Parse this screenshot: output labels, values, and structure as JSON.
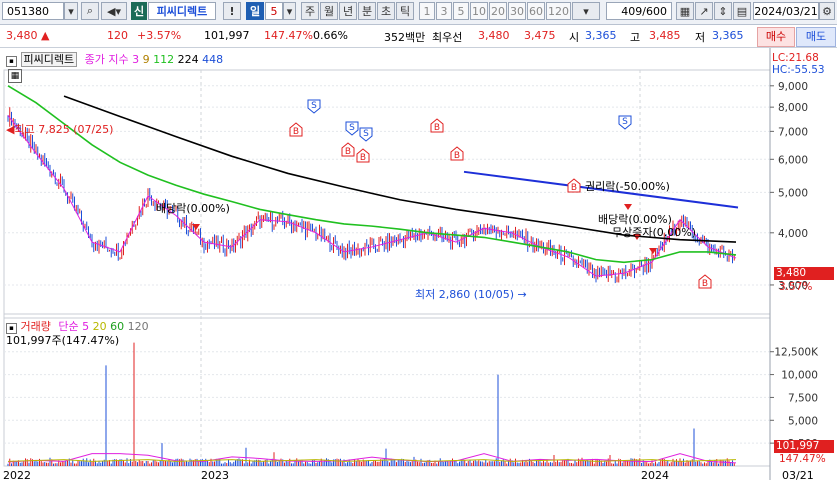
{
  "toolbar": {
    "code": "051380",
    "shin_label": "신",
    "stock_name": "피씨디렉트",
    "alert_label": "!",
    "period_label": "일",
    "period_count": "5",
    "periods": [
      "주",
      "월",
      "년",
      "분",
      "초",
      "틱"
    ],
    "numbers": [
      "1",
      "3",
      "5",
      "10",
      "20",
      "30",
      "60",
      "120"
    ],
    "count": "409/600",
    "date": "2024/03/21"
  },
  "quote": {
    "price": "3,480 ▲",
    "change": "120",
    "change_pct": "+3.57%",
    "volume": "101,997",
    "volume_ratio": "147.47%",
    "turnover": "0.66%",
    "amount": "352백만",
    "best_label": "최우선",
    "best_ask": "3,480",
    "best_bid": "3,475",
    "open_label": "시",
    "open": "3,365",
    "high_label": "고",
    "high": "3,485",
    "low_label": "저",
    "low": "3,365",
    "buy_label": "매수",
    "sell_label": "매도"
  },
  "price_panel": {
    "title": "피씨디렉트",
    "legend_label": "종가 지수",
    "ma_periods": [
      "3",
      "9",
      "112",
      "224",
      "448"
    ],
    "lc": "LC:21.68",
    "hc": "HC:-55.53",
    "current_price_tag": "3,480",
    "current_pct_tag": "3.57%",
    "high_note": "최고 7,825 (07/25)",
    "low_note": "최저 2,860 (10/05)",
    "annotations": [
      "배당락(0.00%)",
      "권리락(-50.00%)",
      "배당락(0.00%)",
      "무상증자(0.00%)"
    ]
  },
  "volume_panel": {
    "title": "거래량",
    "legend_label": "단순",
    "ma_periods": [
      "5",
      "20",
      "60",
      "120"
    ],
    "current_volume": "101,997주(147.47%)",
    "volume_tag": "101,997",
    "ratio_tag": "147.47%"
  },
  "x_axis": {
    "labels": [
      "2022",
      "2023",
      "2024"
    ],
    "cursor_date": "03/21"
  },
  "colors": {
    "up": "#e02020",
    "down": "#1d4fd8",
    "ma112": "#20c020",
    "ma224": "#000000",
    "trend": "#1d2fd8",
    "ma3": "#e020e0",
    "ma9": "#b08000"
  },
  "chart_data": [
    {
      "type": "line",
      "title": "피씨디렉트",
      "ylabel": "",
      "ylim": [
        2500,
        9500
      ],
      "yticks": [
        3000,
        4000,
        5000,
        6000,
        7000,
        8000,
        9000
      ],
      "ytick_labels": [
        "3,000",
        "4,000",
        "5,000",
        "6,000",
        "7,000",
        "8,000",
        "9,000"
      ],
      "x_labels": [
        "2022",
        "2023",
        "2024"
      ],
      "series": [
        {
          "name": "종가",
          "x": [
            "2022-01",
            "2022-02",
            "2022-03",
            "2022-04",
            "2022-05",
            "2022-06",
            "2022-07",
            "2022-08",
            "2022-09",
            "2022-10",
            "2022-11",
            "2022-12",
            "2023-01",
            "2023-02",
            "2023-03",
            "2023-04",
            "2023-05",
            "2023-06",
            "2023-07",
            "2023-08",
            "2023-09",
            "2023-10",
            "2023-11",
            "2023-12",
            "2024-01",
            "2024-02",
            "2024-03"
          ],
          "values": [
            7650,
            6200,
            5100,
            3800,
            3600,
            4900,
            4400,
            3800,
            3700,
            4300,
            4250,
            4000,
            3600,
            3700,
            3850,
            4000,
            3800,
            4100,
            4000,
            3700,
            3500,
            3150,
            3200,
            3400,
            4300,
            3700,
            3480
          ]
        },
        {
          "name": "112",
          "x": [
            "2022-01",
            "2022-02",
            "2022-03",
            "2022-04",
            "2022-05",
            "2022-06",
            "2022-07",
            "2022-08",
            "2022-09",
            "2022-10",
            "2022-11",
            "2022-12",
            "2023-01",
            "2023-02",
            "2023-03",
            "2023-04",
            "2023-05",
            "2023-06",
            "2023-07",
            "2023-08",
            "2023-09",
            "2023-10",
            "2023-11",
            "2023-12",
            "2024-01",
            "2024-02",
            "2024-03"
          ],
          "values": [
            9000,
            8200,
            7300,
            6500,
            5900,
            5500,
            5200,
            4950,
            4750,
            4550,
            4420,
            4300,
            4200,
            4150,
            4080,
            4000,
            3950,
            3900,
            3800,
            3700,
            3600,
            3450,
            3400,
            3450,
            3600,
            3600,
            3540
          ]
        },
        {
          "name": "224",
          "x": [
            "2022-03",
            "2022-05",
            "2022-07",
            "2022-09",
            "2022-11",
            "2023-01",
            "2023-03",
            "2023-05",
            "2023-07",
            "2023-09",
            "2023-11",
            "2024-01",
            "2024-03"
          ],
          "values": [
            8500,
            7600,
            6800,
            6100,
            5550,
            5150,
            4800,
            4550,
            4350,
            4150,
            3950,
            3850,
            3800
          ]
        }
      ],
      "annotations": [
        {
          "text": "최고 7,825 (07/25)",
          "x": "2021-07-25",
          "y": 7825
        },
        {
          "text": "최저 2,860 (10/05)",
          "x": "2023-10-05",
          "y": 2860
        },
        {
          "text": "배당락(0.00%)",
          "x": "2022-12",
          "y": 4850
        },
        {
          "text": "권리락(-50.00%)",
          "x": "2023-12",
          "y": 5900
        },
        {
          "text": "배당락(0.00%)",
          "x": "2023-12",
          "y": 5000
        },
        {
          "text": "무상증자(0.00%)",
          "x": "2023-12",
          "y": 4600
        }
      ]
    },
    {
      "type": "bar",
      "title": "거래량",
      "ylim": [
        0,
        14000
      ],
      "yticks": [
        2500,
        5000,
        7500,
        10000,
        12500
      ],
      "ytick_labels": [
        "2,500",
        "5,000",
        "7,500",
        "10,000",
        "12,500K"
      ],
      "x_labels": [
        "2022",
        "2023",
        "2024"
      ],
      "values": [
        400,
        900,
        600,
        11000,
        13500,
        2500,
        800,
        600,
        2000,
        1500,
        700,
        600,
        800,
        1900,
        1000,
        500,
        700,
        10000,
        600,
        1200,
        900,
        1200,
        700,
        500,
        4100,
        600,
        102
      ]
    }
  ]
}
